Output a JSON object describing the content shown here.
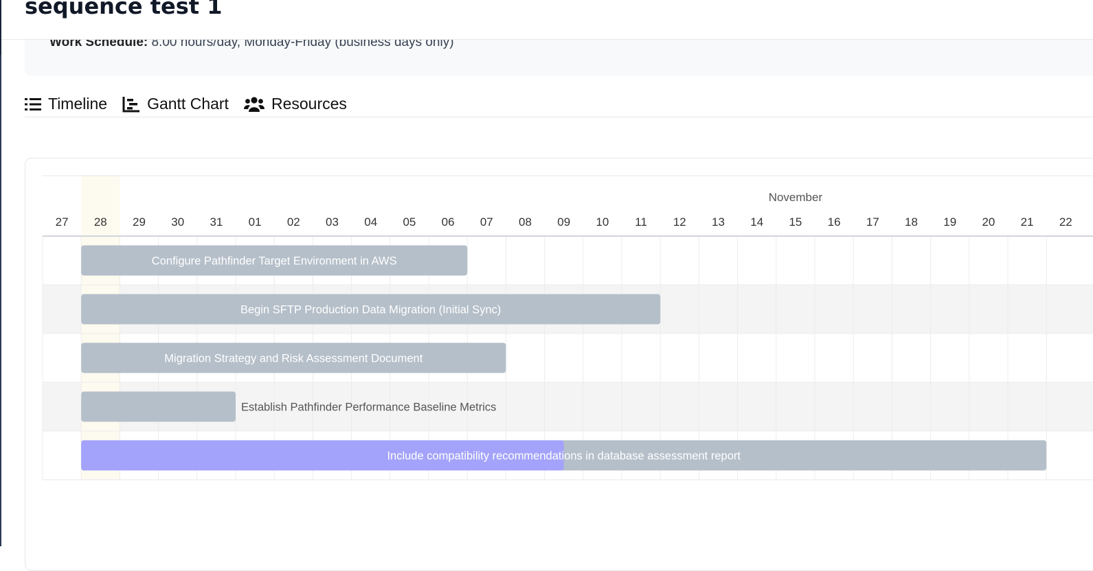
{
  "header": {
    "title": "sequence test 1"
  },
  "schedule": {
    "label": "Work Schedule:",
    "value": "8.00 hours/day, Monday-Friday (business days only)"
  },
  "tabs": [
    {
      "label": "Timeline",
      "icon": "list-icon"
    },
    {
      "label": "Gantt Chart",
      "icon": "chart-icon"
    },
    {
      "label": "Resources",
      "icon": "users-icon"
    }
  ],
  "gantt": {
    "month_label": "November",
    "days": [
      "27",
      "28",
      "29",
      "30",
      "31",
      "01",
      "02",
      "03",
      "04",
      "05",
      "06",
      "07",
      "08",
      "09",
      "10",
      "11",
      "12",
      "13",
      "14",
      "15",
      "16",
      "17",
      "18",
      "19",
      "20",
      "21",
      "22"
    ],
    "today_day": "28",
    "colors": {
      "bar": "#b5bfc9",
      "progress": "#a3a3fb",
      "today": "#fdfaef",
      "row_alt": "#f4f4f4"
    },
    "tasks": [
      {
        "name": "Configure Pathfinder Target Environment in AWS",
        "start": "28",
        "end": "07",
        "progress": 0
      },
      {
        "name": "Begin SFTP Production Data Migration (Initial Sync)",
        "start": "28",
        "end": "12",
        "progress": 0
      },
      {
        "name": "Migration Strategy and Risk Assessment Document",
        "start": "28",
        "end": "08",
        "progress": 0
      },
      {
        "name": "Establish Pathfinder Performance Baseline Metrics",
        "start": "28",
        "end": "01",
        "progress": 0
      },
      {
        "name": "Include compatibility recommendations in database assessment report",
        "start": "28",
        "end": "22",
        "progress": 0.5
      }
    ]
  }
}
